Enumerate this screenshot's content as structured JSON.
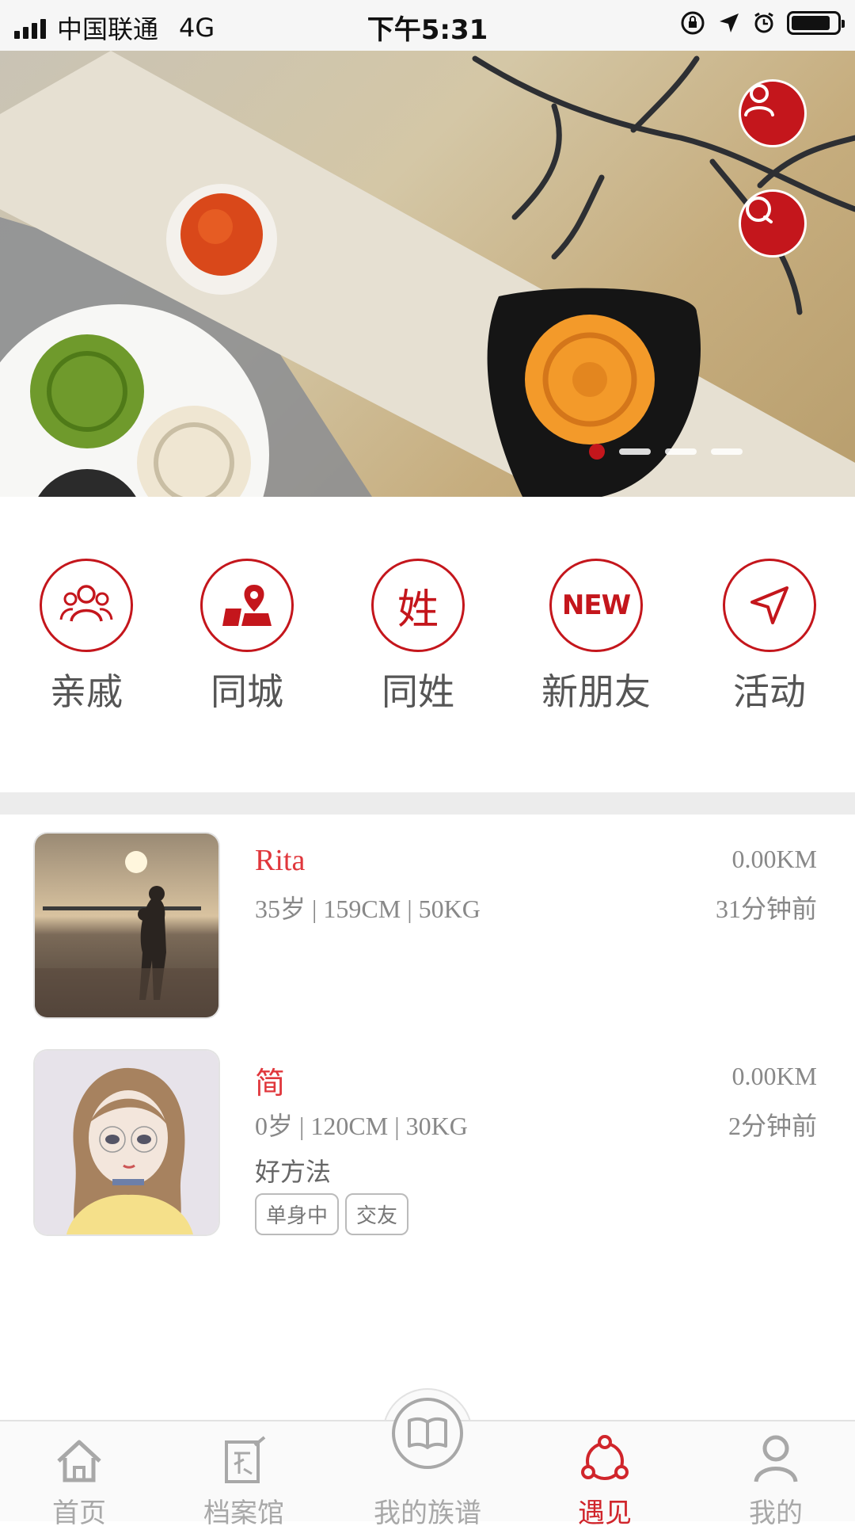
{
  "status_bar": {
    "carrier": "中国联通",
    "network": "4G",
    "time": "下午5:31",
    "battery_level": 0.85
  },
  "banner": {
    "slide_count": 4,
    "active_slide": 0,
    "buttons": [
      {
        "icon": "user-icon"
      },
      {
        "icon": "search-icon"
      }
    ]
  },
  "categories": [
    {
      "label": "亲戚",
      "icon": "relatives-icon"
    },
    {
      "label": "同城",
      "icon": "map-pin-icon"
    },
    {
      "label": "同姓",
      "icon": "surname-icon",
      "glyph": "姓"
    },
    {
      "label": "新朋友",
      "icon": "new-badge-icon",
      "glyph": "NEW"
    },
    {
      "label": "活动",
      "icon": "navigation-arrow-icon"
    }
  ],
  "people": [
    {
      "name": "Rita",
      "stats": "35岁 | 159CM | 50KG",
      "distance": "0.00KM",
      "time": "31分钟前"
    },
    {
      "name": "简",
      "stats": "0岁 | 120CM | 30KG",
      "distance": "0.00KM",
      "time": "2分钟前",
      "bio": "好方法",
      "tags": [
        "单身中",
        "交友"
      ]
    }
  ],
  "tabbar": {
    "items": [
      {
        "label": "首页",
        "icon": "home-icon",
        "active": false
      },
      {
        "label": "档案馆",
        "icon": "archive-icon",
        "active": false
      },
      {
        "label": "我的族谱",
        "icon": "book-icon",
        "active": false
      },
      {
        "label": "遇见",
        "icon": "meet-icon",
        "active": true
      },
      {
        "label": "我的",
        "icon": "profile-icon",
        "active": false
      }
    ]
  },
  "colors": {
    "accent": "#c4161c",
    "name": "#e0373c",
    "inactive_tab": "#a8a8a8"
  }
}
